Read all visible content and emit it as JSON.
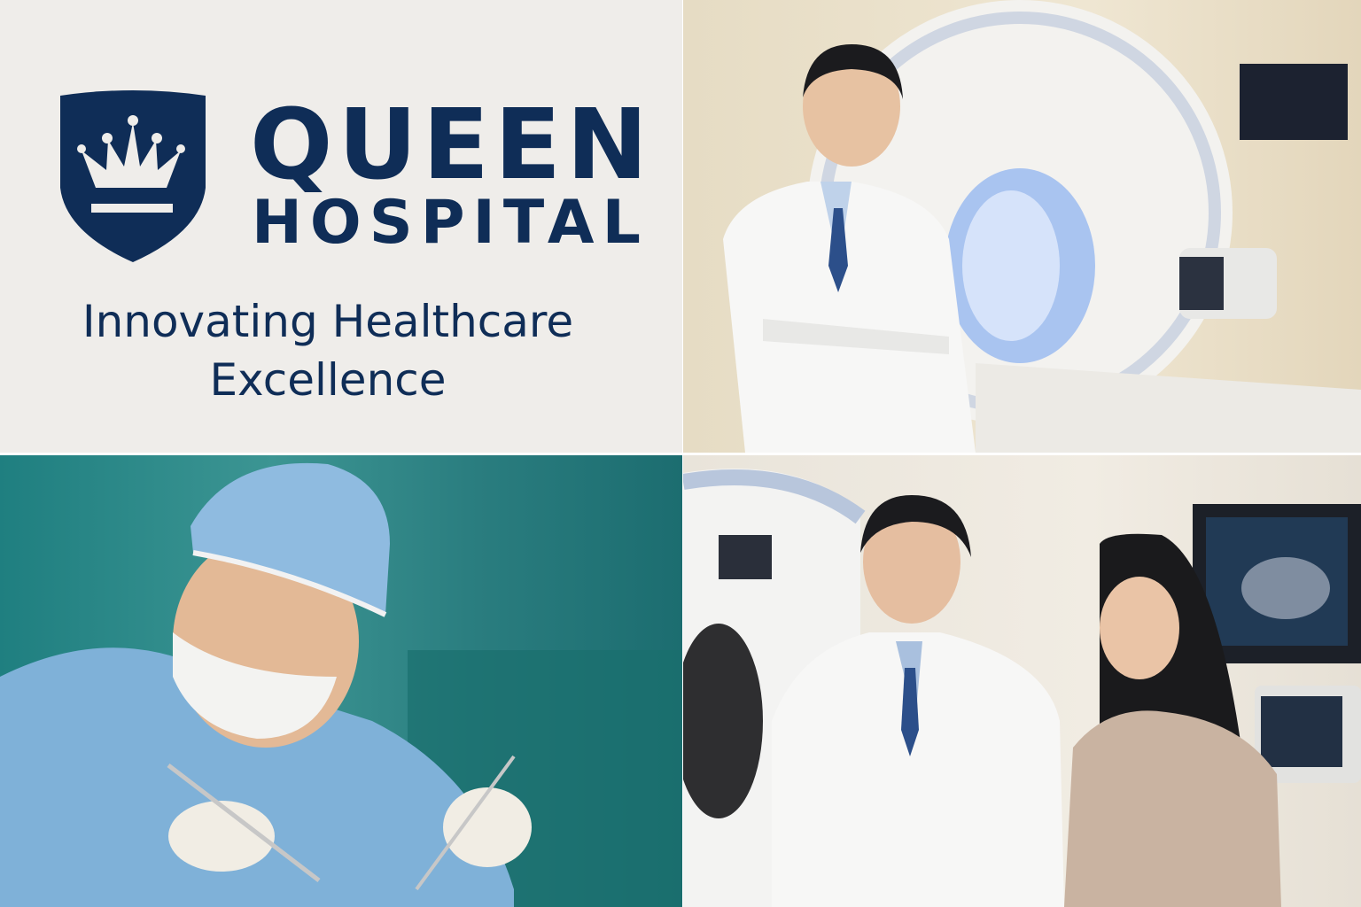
{
  "brand": {
    "name_line1": "QUEEN",
    "name_line2": "HOSPITAL",
    "tagline_line1": "Innovating Healthcare",
    "tagline_line2": "Excellence",
    "logo_icon": "crown-shield-icon",
    "colors": {
      "navy": "#0f2d57",
      "background": "#efedea",
      "teal": "#2a8a8a"
    }
  },
  "photos": [
    {
      "subject": "doctor-with-mri-scanner"
    },
    {
      "subject": "surgeon-operating"
    },
    {
      "subject": "doctor-and-patient-with-ultrasound"
    }
  ]
}
